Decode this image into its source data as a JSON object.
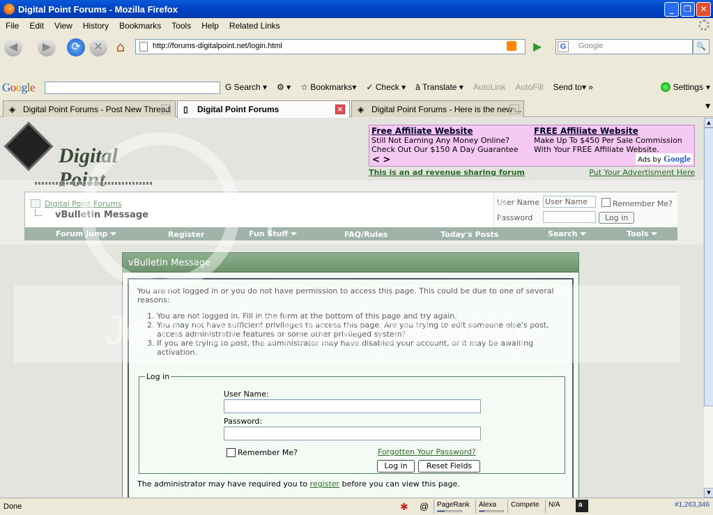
{
  "window": {
    "title": "Digital Point Forums - Mozilla Firefox",
    "min": "_",
    "max": "❐",
    "close": "✕"
  },
  "menu": [
    "File",
    "Edit",
    "View",
    "History",
    "Bookmarks",
    "Tools",
    "Help",
    "Related Links"
  ],
  "nav": {
    "url": "http://forums-digitalpoint.net/login.html",
    "search_placeholder": "Google",
    "search_engine": "G"
  },
  "google_toolbar": {
    "search": "Search",
    "bookmarks": "Bookmarks",
    "check": "Check",
    "translate": "Translate",
    "autolink": "AutoLink",
    "autofill": "AutoFill",
    "sendto": "Send to",
    "more": "»",
    "settings": "Settings"
  },
  "tabs": [
    {
      "label": "Digital Point Forums - Post New Thread",
      "active": false
    },
    {
      "label": "Digital Point Forums",
      "active": true
    },
    {
      "label": "Digital Point Forums - Here is the new ...",
      "active": false
    }
  ],
  "site": {
    "logo_text": "Digital Point"
  },
  "ad": {
    "left_title": "Free Affiliate Website",
    "left_line1": "Still Not Earning Any Money Online?",
    "left_line2": "Check Out Our $150 A Day Guarantee",
    "right_title": "FREE Affiliate Website",
    "right_line1": "Make Up To $450 Per Sale Commission",
    "right_line2": "With Your FREE Affiliate Website.",
    "arrows": "< >",
    "ads_by": "Ads by",
    "google": "Google",
    "revenue_link": "This is an ad revenue sharing forum",
    "advert_link": "Put Your Advertisment Here"
  },
  "breadcrumb": {
    "root": "Digital Point Forums",
    "current": "vBulletin Message"
  },
  "header_login": {
    "username_label": "User Name",
    "username_value": "User Name",
    "password_label": "Password",
    "remember": "Remember Me?",
    "button": "Log in"
  },
  "navstrip": {
    "forum_jump": "Forum Jump ⏷",
    "register": "Register",
    "fun_stuff": "Fun Stuff ⏷",
    "faq": "FAQ/Rules",
    "todays_posts": "Today's Posts",
    "search": "Search ⏷",
    "tools": "Tools ⏷"
  },
  "message": {
    "title": "vBulletin Message",
    "intro": "You are not logged in or you do not have permission to access this page. This could be due to one of several reasons:",
    "reasons": [
      "You are not logged in. Fill in the form at the bottom of this page and try again.",
      "You may not have sufficient privileges to access this page. Are you trying to edit someone else's post, access administrative features or some other privileged system?",
      "If you are trying to post, the administrator may have disabled your account, or it may be awaiting activation."
    ],
    "login_legend": "Log in",
    "username_label": "User Name:",
    "password_label": "Password:",
    "remember": "Remember Me?",
    "forgot": "Forgotten Your Password?",
    "login_button": "Log in",
    "reset_button": "Reset Fields",
    "reg_prefix": "The administrator may have required you to ",
    "reg_link": "register",
    "reg_suffix": " before you can view this page."
  },
  "watermark": {
    "line1": "photobucket",
    "line2": "Join for Share privately."
  },
  "status": {
    "text": "Done",
    "pagerank": "PageRank",
    "pagerank_level": 0.3,
    "alexa": "Alexa",
    "alexa_level": 0.2,
    "compete": "Compete",
    "na": "N/A",
    "rank": "#1,263,346"
  }
}
